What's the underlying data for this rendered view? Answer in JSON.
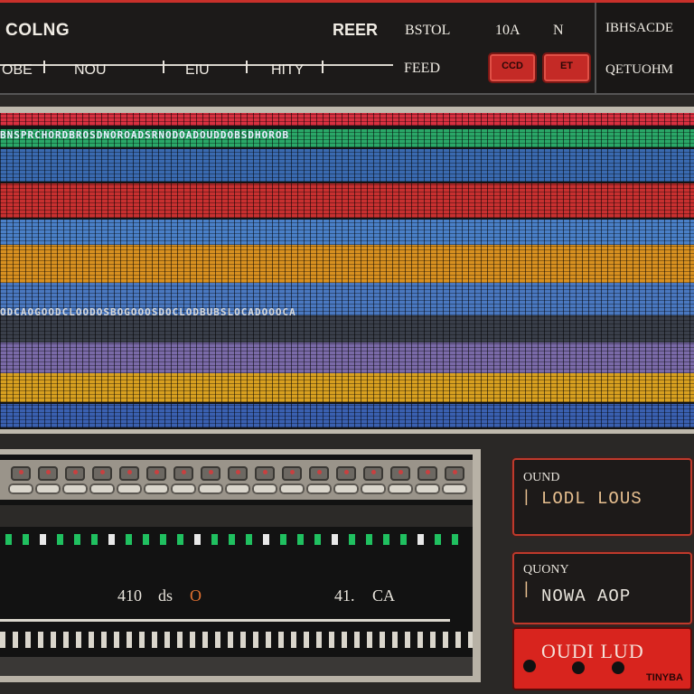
{
  "header": {
    "app_title": "COLNG",
    "item_reer": "REER",
    "item_bstol": "BSTOL",
    "item_10a": "10A",
    "item_n": "N",
    "sub_labels": [
      "OBE",
      "NOU",
      "EIU",
      "HITY"
    ],
    "feed_label": "FEED",
    "right_title": "IBHSACDE",
    "right_sub": "QETUOHM"
  },
  "header_buttons": [
    {
      "label": "CCD",
      "color": "#c42a26"
    },
    {
      "label": "ET",
      "color": "#c42a26"
    }
  ],
  "spectrum": {
    "top_text": "BNSPRCHORDBROSDNOROADSRNODOADOUDDOBSDHOROB",
    "mid_text": "ODCAOGOODCLOODOSBOGOOOSDOCLODBUBSLOCADOOOCA",
    "bands": [
      {
        "color": "#d83040"
      },
      {
        "color": "#2aa868"
      },
      {
        "color": "#3a6ab0"
      },
      {
        "color": "#c83030"
      },
      {
        "color": "#4a80c8"
      },
      {
        "color": "#d89020"
      },
      {
        "color": "#4a78c0"
      },
      {
        "color": "#3a3f4a"
      },
      {
        "color": "#7a6aa8"
      },
      {
        "color": "#d8a020"
      },
      {
        "color": "#3a60b0"
      }
    ]
  },
  "mixer": {
    "number_labels": [
      "410",
      "ds",
      "O",
      "41.",
      "CA"
    ]
  },
  "panels": [
    {
      "small": "OUND",
      "big": "LODL LOUS"
    },
    {
      "small": "QUONY",
      "big": "NOWA AOP"
    },
    {
      "big": "OUDI LUD",
      "tiny": "TINYBA"
    }
  ],
  "colors": {
    "accent_red": "#c42a26",
    "background": "#2a2826",
    "led_green": "#20c060"
  }
}
